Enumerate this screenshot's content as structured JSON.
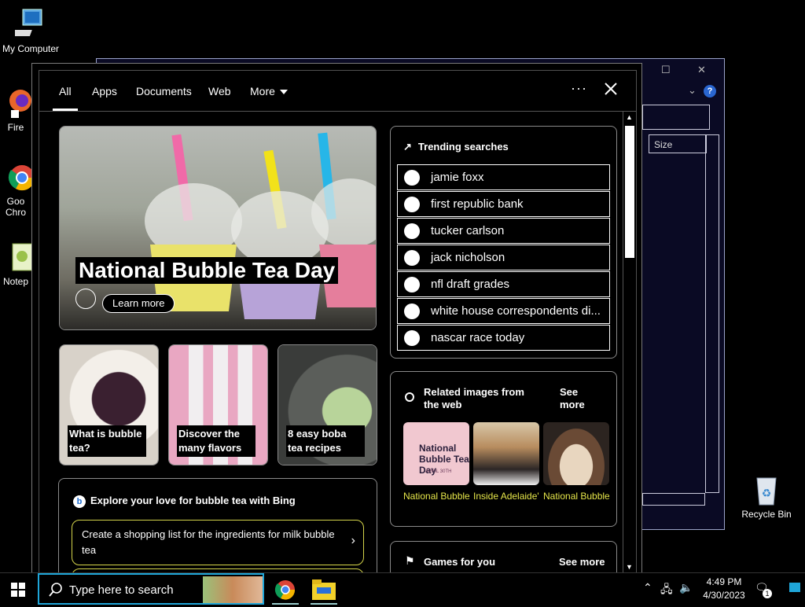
{
  "desktop": {
    "icons": [
      {
        "label": "My Computer"
      },
      {
        "label": "Fire"
      },
      {
        "label": "Goo Chro"
      },
      {
        "label": "Notep"
      },
      {
        "label": "Recycle Bin"
      }
    ]
  },
  "bg_window": {
    "column_size": "Size",
    "help": "?"
  },
  "search_panel": {
    "tabs": [
      "All",
      "Apps",
      "Documents",
      "Web",
      "More"
    ],
    "more_menu": "···",
    "hero": {
      "title": "National Bubble Tea Day",
      "button": "Learn more"
    },
    "mini_cards": [
      {
        "caption": "What is bubble tea?"
      },
      {
        "caption": "Discover the many flavors"
      },
      {
        "caption": "8 easy boba tea recipes"
      }
    ],
    "explore": {
      "title": "Explore your love for bubble tea with Bing",
      "chips": [
        "Create a shopping list for the ingredients for milk bubble tea"
      ]
    },
    "trending": {
      "title": "Trending searches",
      "items": [
        "jamie foxx",
        "first republic bank",
        "tucker carlson",
        "jack nicholson",
        "nfl draft grades",
        "white house correspondents di...",
        "nascar race today"
      ]
    },
    "related": {
      "title": "Related images from the web",
      "see_more": "See more",
      "images": [
        {
          "caption": "National Bubble Tea D...",
          "overlay": "National Bubble Tea Day",
          "date": "APRIL 30TH"
        },
        {
          "caption": "Inside Adelaide's Be..."
        },
        {
          "caption": "National Bubble Tea D..."
        }
      ]
    },
    "games": {
      "title": "Games for you",
      "see_more": "See more"
    }
  },
  "taskbar": {
    "search_placeholder": "Type here to search",
    "time": "4:49 PM",
    "date": "4/30/2023",
    "notification_count": "1"
  }
}
